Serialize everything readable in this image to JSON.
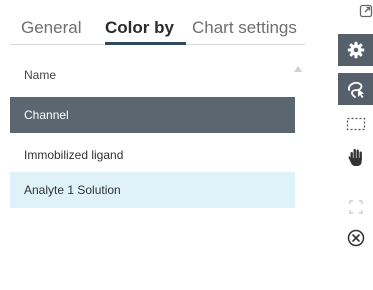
{
  "tabs": {
    "general": "General",
    "color_by": "Color by",
    "chart_settings": "Chart settings",
    "active": "Color by"
  },
  "list": {
    "header": "Name",
    "rows": [
      {
        "label": "Channel",
        "state": "selected"
      },
      {
        "label": "Immobilized ligand",
        "state": "normal"
      },
      {
        "label": "Analyte 1 Solution",
        "state": "highlighted"
      }
    ]
  },
  "toolbar": {
    "buttons": [
      {
        "icon": "popout-icon",
        "active": false
      },
      {
        "icon": "gear-icon",
        "active": true
      },
      {
        "icon": "lasso-select-icon",
        "active": true
      },
      {
        "icon": "rectangle-select-icon",
        "active": false
      },
      {
        "icon": "pan-hand-icon",
        "active": false
      },
      {
        "icon": "expand-icon",
        "active": false
      },
      {
        "icon": "close-circle-icon",
        "active": false
      }
    ]
  },
  "colors": {
    "accent_dark": "#55606a",
    "selected_row": "#5b6770",
    "highlight_row": "#def2f8",
    "tab_underline": "#2e4a5e"
  }
}
